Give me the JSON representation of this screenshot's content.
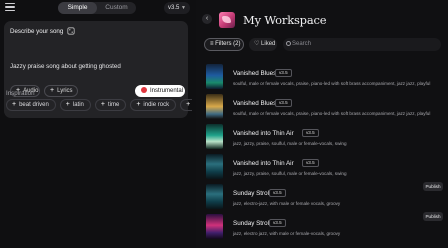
{
  "topbar": {
    "mode_simple": "Simple",
    "mode_custom": "Custom",
    "version": "v3.5"
  },
  "create": {
    "describe_label": "Describe your song",
    "prompt_text": "Jazzy praise song about getting ghosted",
    "audio_label": "Audio",
    "lyrics_label": "Lyrics",
    "instrumental_label": "Instrumental",
    "inspiration_label": "Inspiration",
    "inspiration_tags": [
      "beat driven",
      "latin",
      "time",
      "indie rock",
      "keys"
    ]
  },
  "workspace": {
    "title": "My Workspace",
    "filters_label": "Filters (2)",
    "liked_label": "Liked",
    "search_placeholder": "Search"
  },
  "songs": [
    {
      "title": "Vanished Blues",
      "version": "v3.5",
      "desc": "soulful, male or female vocals, praise, piano-led with soft brass accompaniment, jazz jazz, playful",
      "publish": ""
    },
    {
      "title": "Vanished Blues",
      "version": "v3.5",
      "desc": "soulful, male or female vocals, praise, piano-led with soft brass accompaniment, jazz jazz, playful",
      "publish": ""
    },
    {
      "title": "Vanished into Thin Air",
      "version": "v3.5",
      "desc": "jazz, jazzy, praise, soulful, male or female-vocals, swing",
      "publish": ""
    },
    {
      "title": "Vanished into Thin Air",
      "version": "v3.5",
      "desc": "jazz, jazzy, praise, soulful, male or female-vocals, swing",
      "publish": ""
    },
    {
      "title": "Sunday Stroll",
      "version": "v3.5",
      "desc": "jazz, electro-jazz, with male or female vocals, groovy",
      "publish": "Publish"
    },
    {
      "title": "Sunday Stroll",
      "version": "v3.5",
      "desc": "jazz, electro jazz, with male or female-vocals, groovy",
      "publish": "Publish"
    }
  ],
  "colors": {
    "instrumental_dot": "#e0363f",
    "background": "#101012",
    "card": "#232326"
  }
}
